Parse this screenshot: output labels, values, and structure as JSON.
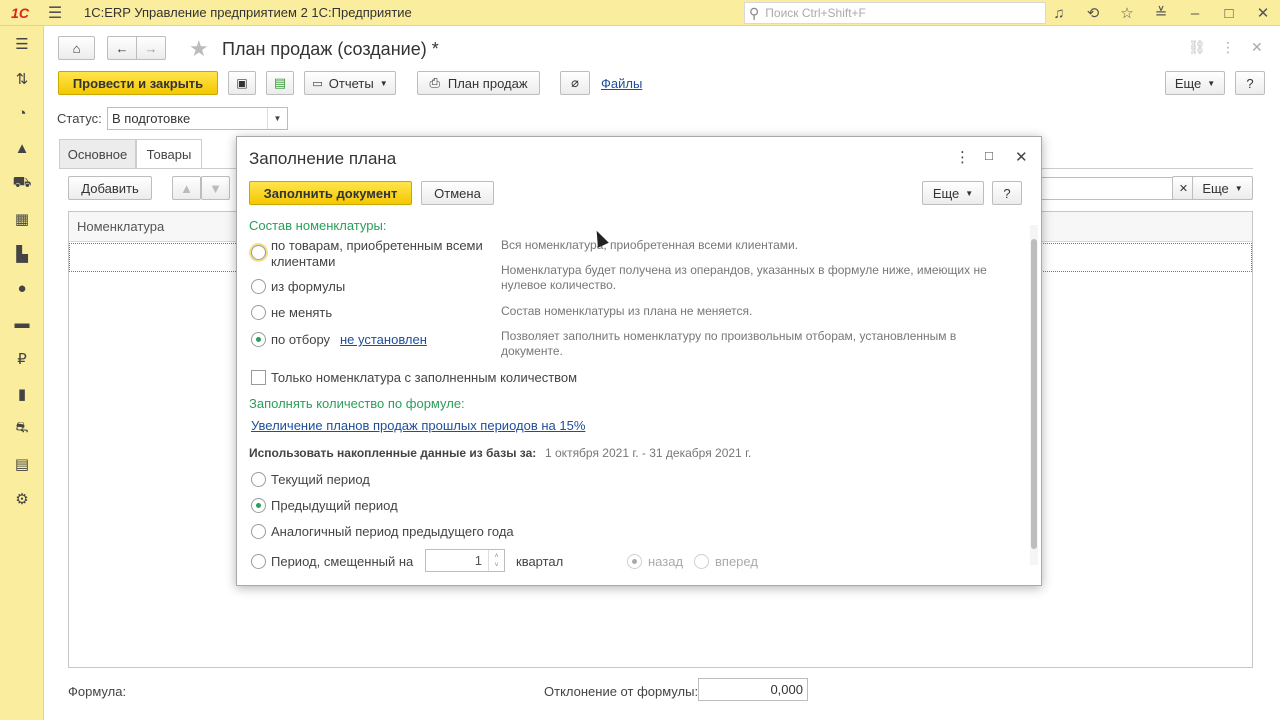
{
  "titlebar": {
    "logo": "1С",
    "app_title": "1С:ERP Управление предприятием 2 1С:Предприятие",
    "search_placeholder": "Поиск Ctrl+Shift+F"
  },
  "form": {
    "title": "План продаж (создание) *",
    "post_close_label": "Провести и закрыть",
    "reports_label": "Отчеты",
    "sales_plan_label": "План продаж",
    "files_label": "Файлы",
    "more_label": "Еще",
    "help_label": "?",
    "status_label": "Статус:",
    "status_value": "В подготовке",
    "tabs": [
      "Основное",
      "Товары"
    ],
    "add_label": "Добавить",
    "more2_label": "Еще",
    "column_nomenclature": "Номенклатура",
    "formula_label": "Формула:",
    "deviation_label": "Отклонение от формулы:",
    "deviation_value": "0,000"
  },
  "modal": {
    "title": "Заполнение плана",
    "fill_label": "Заполнить документ",
    "cancel_label": "Отмена",
    "more_label": "Еще",
    "help_label": "?",
    "composition_title": "Состав номенклатуры:",
    "options": [
      {
        "label": "по товарам, приобретенным всеми клиентами",
        "desc": "Вся номенклатура, приобретенная всеми клиентами."
      },
      {
        "label": "из формулы",
        "desc": "Номенклатура будет получена из операндов, указанных в формуле ниже, имеющих не нулевое количество."
      },
      {
        "label": "не менять",
        "desc": "Состав номенклатуры из плана не меняется."
      },
      {
        "label": "по отбору",
        "desc": "Позволяет заполнить номенклатуру по произвольным отборам, установленным в документе."
      }
    ],
    "filter_link": "не установлен",
    "only_filled_label": "Только номенклатура с заполненным количеством",
    "fill_qty_title": "Заполнять количество по формуле:",
    "formula_link": "Увеличение планов продаж прошлых периодов на 15%",
    "use_data_label": "Использовать накопленные данные из базы за:",
    "use_data_period": "1 октября 2021 г. - 31 декабря 2021 г.",
    "periods": [
      "Текущий период",
      "Предыдущий период",
      "Аналогичный период предыдущего года",
      "Период, смещенный на"
    ],
    "shift_value": "1",
    "shift_unit": "квартал",
    "direction": [
      "назад",
      "вперед"
    ]
  }
}
